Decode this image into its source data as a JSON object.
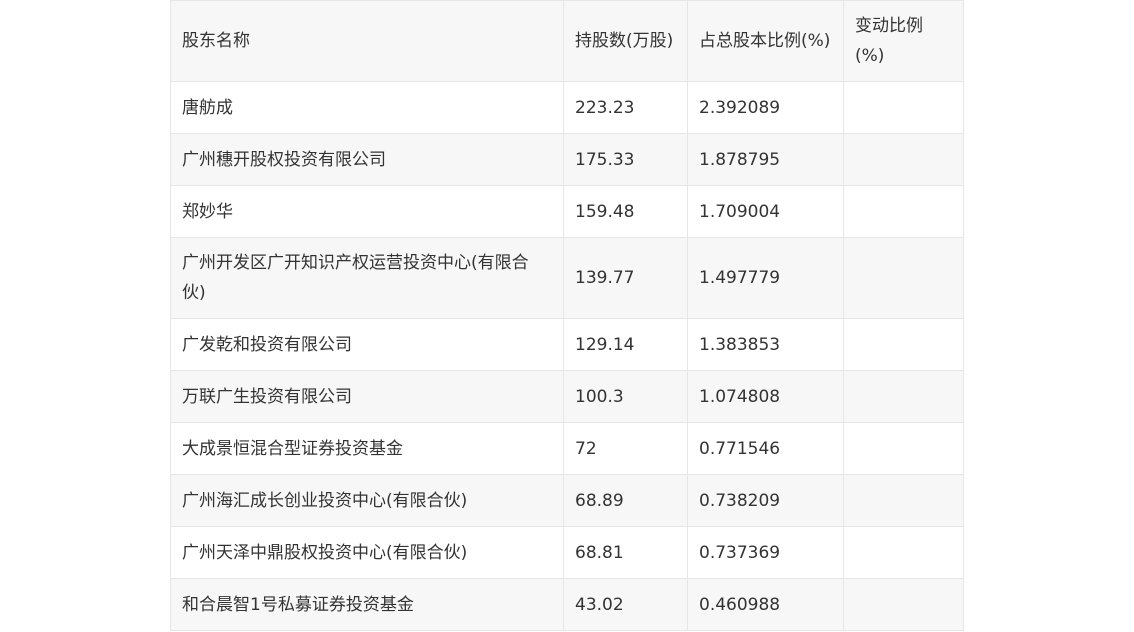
{
  "table": {
    "headers": [
      "股东名称",
      "持股数(万股)",
      "占总股本比例(%)",
      "变动比例(%)"
    ],
    "rows": [
      {
        "name": "唐舫成",
        "shares": "223.23",
        "ratio": "2.392089",
        "change": ""
      },
      {
        "name": "广州穗开股权投资有限公司",
        "shares": "175.33",
        "ratio": "1.878795",
        "change": ""
      },
      {
        "name": "郑妙华",
        "shares": "159.48",
        "ratio": "1.709004",
        "change": ""
      },
      {
        "name": "广州开发区广开知识产权运营投资中心(有限合伙)",
        "shares": "139.77",
        "ratio": "1.497779",
        "change": ""
      },
      {
        "name": "广发乾和投资有限公司",
        "shares": "129.14",
        "ratio": "1.383853",
        "change": ""
      },
      {
        "name": "万联广生投资有限公司",
        "shares": "100.3",
        "ratio": "1.074808",
        "change": ""
      },
      {
        "name": "大成景恒混合型证券投资基金",
        "shares": "72",
        "ratio": "0.771546",
        "change": ""
      },
      {
        "name": "广州海汇成长创业投资中心(有限合伙)",
        "shares": "68.89",
        "ratio": "0.738209",
        "change": ""
      },
      {
        "name": "广州天泽中鼎股权投资中心(有限合伙)",
        "shares": "68.81",
        "ratio": "0.737369",
        "change": ""
      },
      {
        "name": "和合晨智1号私募证券投资基金",
        "shares": "43.02",
        "ratio": "0.460988",
        "change": ""
      }
    ]
  }
}
